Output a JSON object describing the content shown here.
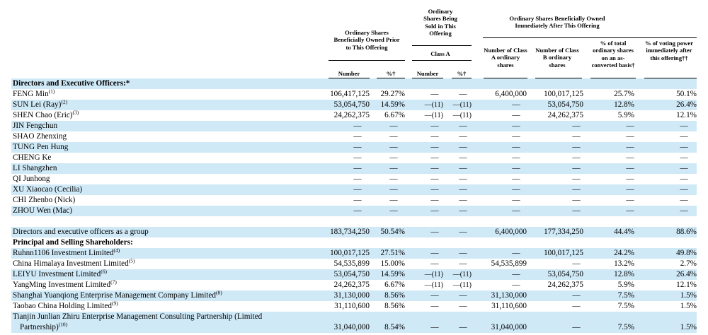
{
  "header": {
    "prior": "Ordinary Shares Beneficially Owned Prior to This Offering",
    "sold": "Ordinary Shares Being Sold in This Offering",
    "class_a": "Class A",
    "after": "Ordinary Shares Beneficially Owned Immediately After This Offering",
    "col_number": "Number",
    "col_pct": "%†",
    "col_sold_number": "Number",
    "col_sold_pct": "%†",
    "col_class_a": "Number of Class A ordinary shares",
    "col_class_b": "Number of Class B ordinary shares",
    "col_total": "% of total ordinary shares on an as-converted basis†",
    "col_voting": "% of voting power immediately after this offering††"
  },
  "dash": "—",
  "rows": [
    {
      "label": "Directors and Executive Officers:*",
      "section": true
    },
    {
      "label": "FENG Min",
      "sup": "(1)",
      "vals": [
        "106,417,125",
        "29.27%",
        "—",
        "—",
        "6,400,000",
        "100,017,125",
        "25.7%",
        "50.1%"
      ]
    },
    {
      "label": "SUN Lei (Ray)",
      "sup": "(2)",
      "vals": [
        "53,054,750",
        "14.59%",
        "—(11)",
        "—(11)",
        "—",
        "53,054,750",
        "12.8%",
        "26.4%"
      ]
    },
    {
      "label": "SHEN Chao (Eric)",
      "sup": "(3)",
      "vals": [
        "24,262,375",
        "6.67%",
        "—(11)",
        "—(11)",
        "—",
        "24,262,375",
        "5.9%",
        "12.1%"
      ]
    },
    {
      "label": "JIN Fengchun",
      "vals": [
        "—",
        "—",
        "—",
        "—",
        "—",
        "—",
        "—",
        "—"
      ]
    },
    {
      "label": "SHAO Zhenxing",
      "vals": [
        "—",
        "—",
        "—",
        "—",
        "—",
        "—",
        "—",
        "—"
      ]
    },
    {
      "label": "TUNG Pen Hung",
      "vals": [
        "—",
        "—",
        "—",
        "—",
        "—",
        "—",
        "—",
        "—"
      ]
    },
    {
      "label": "CHENG Ke",
      "vals": [
        "—",
        "—",
        "—",
        "—",
        "—",
        "—",
        "—",
        "—"
      ]
    },
    {
      "label": "LI Shangzhen",
      "vals": [
        "—",
        "—",
        "—",
        "—",
        "—",
        "—",
        "—",
        "—"
      ]
    },
    {
      "label": "QI Junhong",
      "vals": [
        "—",
        "—",
        "—",
        "—",
        "—",
        "—",
        "—",
        "—"
      ]
    },
    {
      "label": "XU Xiaocao (Cecilia)",
      "vals": [
        "—",
        "—",
        "—",
        "—",
        "—",
        "—",
        "—",
        "—"
      ]
    },
    {
      "label": "CHI Zhenbo (Nick)",
      "vals": [
        "—",
        "—",
        "—",
        "—",
        "—",
        "—",
        "—",
        "—"
      ]
    },
    {
      "label": "ZHOU Wen (Mac)",
      "vals": [
        "—",
        "—",
        "—",
        "—",
        "—",
        "—",
        "—",
        "—"
      ]
    },
    {
      "label": "",
      "blank": true
    },
    {
      "label": "Directors and executive officers as a group",
      "vals": [
        "183,734,250",
        "50.54%",
        "—",
        "—",
        "6,400,000",
        "177,334,250",
        "44.4%",
        "88.6%"
      ]
    },
    {
      "label": "Principal and Selling Shareholders:",
      "section": true
    },
    {
      "label": "Ruhnn1106 Investment Limited",
      "sup": "(4)",
      "vals": [
        "100,017,125",
        "27.51%",
        "—",
        "—",
        "—",
        "100,017,125",
        "24.2%",
        "49.8%"
      ]
    },
    {
      "label": "China Himalaya Investment Limited",
      "sup": "(5)",
      "vals": [
        "54,535,899",
        "15.00%",
        "—",
        "—",
        "54,535,899",
        "—",
        "13.2%",
        "2.7%"
      ]
    },
    {
      "label": "LEIYU Investment Limited",
      "sup": "(6)",
      "vals": [
        "53,054,750",
        "14.59%",
        "—(11)",
        "—(11)",
        "—",
        "53,054,750",
        "12.8%",
        "26.4%"
      ]
    },
    {
      "label": "YangMing Investment Limited",
      "sup": "(7)",
      "vals": [
        "24,262,375",
        "6.67%",
        "—(11)",
        "—(11)",
        "—",
        "24,262,375",
        "5.9%",
        "12.1%"
      ]
    },
    {
      "label": "Shanghai Yuanqiong Enterprise Management Company Limited",
      "sup": "(8)",
      "vals": [
        "31,130,000",
        "8.56%",
        "—",
        "—",
        "31,130,000",
        "—",
        "7.5%",
        "1.5%"
      ]
    },
    {
      "label": "Taobao China Holding Limited",
      "sup": "(9)",
      "vals": [
        "31,110,600",
        "8.56%",
        "—",
        "—",
        "31,110,600",
        "—",
        "7.5%",
        "1.5%"
      ]
    },
    {
      "label": "Tianjin Junlian Zhiru Enterprise Management Consulting Partnership (Limited",
      "label2": "Partnership)",
      "sup": "(10)",
      "tall": true,
      "vals": [
        "31,040,000",
        "8.54%",
        "—",
        "—",
        "31,040,000",
        "—",
        "7.5%",
        "1.5%"
      ]
    }
  ]
}
